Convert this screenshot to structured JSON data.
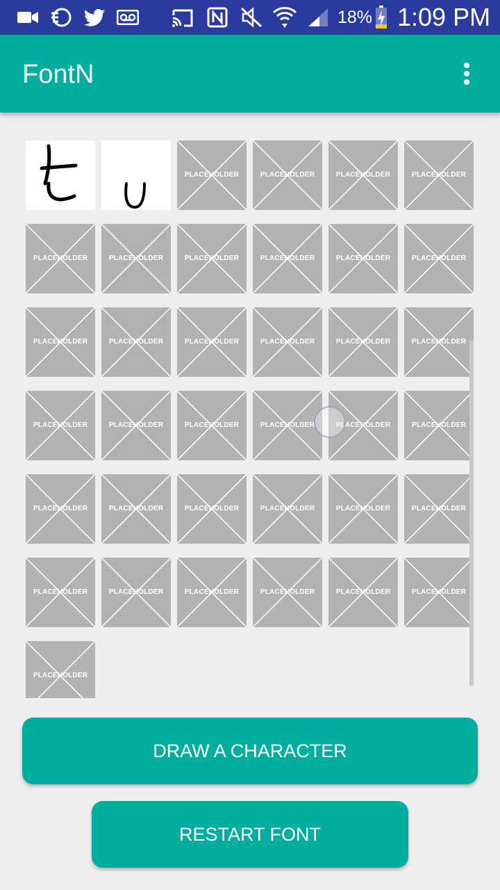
{
  "status_bar": {
    "battery_percent": "18%",
    "time": "1:09 PM",
    "icons": [
      "video-camera-icon",
      "dashboard-icon",
      "twitter-icon",
      "voicemail-icon",
      "cast-icon",
      "nfc-icon",
      "mute-icon",
      "wifi-icon",
      "signal-icon",
      "battery-charging-icon"
    ]
  },
  "app_bar": {
    "title": "FontN",
    "menu_icon": "overflow-menu-icon"
  },
  "grid": {
    "placeholder_label": "PLACEHOLDER",
    "drawn_characters": [
      "t",
      "u"
    ],
    "total_tiles": 37
  },
  "buttons": {
    "draw": "DRAW A CHARACTER",
    "restart": "RESTART FONT"
  },
  "colors": {
    "status_bar": "#2b3a9e",
    "accent": "#00ae9f",
    "placeholder": "#b2b2b2",
    "background": "#eeeeee"
  }
}
